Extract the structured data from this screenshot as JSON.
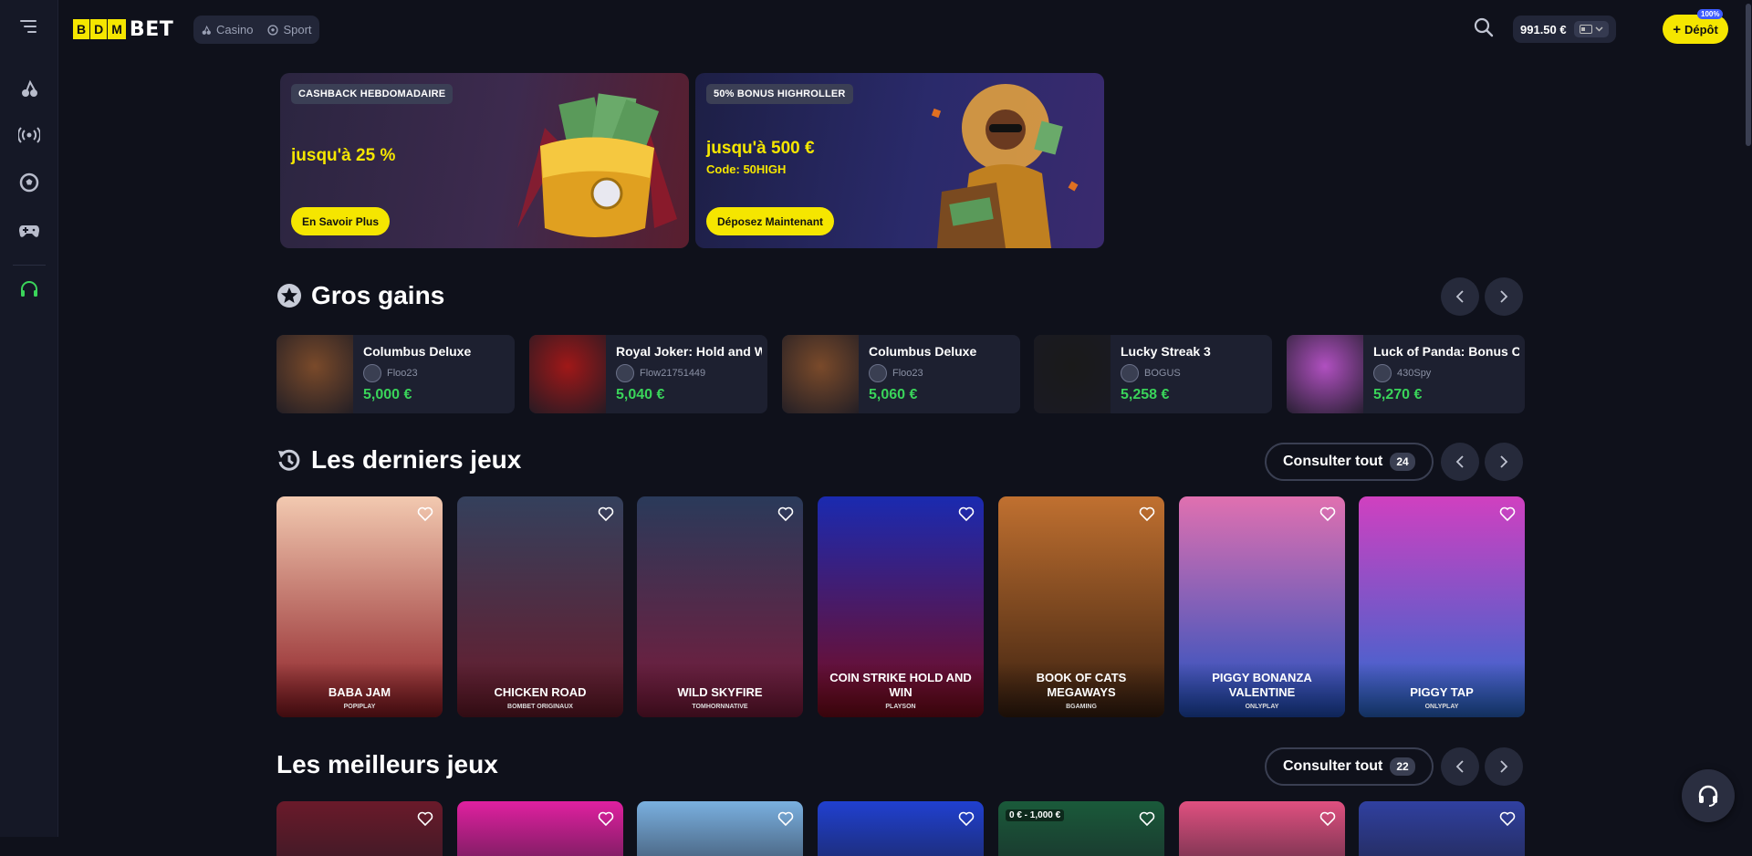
{
  "header": {
    "logo_box": [
      "B",
      "D",
      "M"
    ],
    "logo_text": "BET",
    "nav": [
      {
        "label": "Casino",
        "icon": "cherries-icon"
      },
      {
        "label": "Sport",
        "icon": "soccer-ball-icon"
      }
    ],
    "balance": "991.50 €",
    "deposit_label": "Dépôt",
    "deposit_badge": "100%"
  },
  "sidebar": {
    "items": [
      "menu-icon",
      "cherries-icon",
      "live-broadcast-icon",
      "soccer-ball-icon",
      "gamepad-icon",
      "headset-icon"
    ]
  },
  "banners": [
    {
      "tag": "CASHBACK HEBDOMADAIRE",
      "title": "jusqu'à 25 %",
      "subtitle": "",
      "button": "En Savoir Plus"
    },
    {
      "tag": "50% BONUS HIGHROLLER",
      "title": "jusqu'à 500 €",
      "subtitle": "Code: 50HIGH",
      "button": "Déposez Maintenant"
    }
  ],
  "big_wins": {
    "title": "Gros gains",
    "items": [
      {
        "game": "Columbus Deluxe",
        "user": "Floo23",
        "amount": "5,000 €",
        "thumb_color": "#7a4a2a"
      },
      {
        "game": "Royal Joker: Hold and Win",
        "user": "Flow21751449",
        "amount": "5,040 €",
        "thumb_color": "#a01818"
      },
      {
        "game": "Columbus Deluxe",
        "user": "Floo23",
        "amount": "5,060 €",
        "thumb_color": "#7a4a2a"
      },
      {
        "game": "Lucky Streak 3",
        "user": "BOGUS",
        "amount": "5,258 €",
        "thumb_color": "#1a1a1a"
      },
      {
        "game": "Luck of Panda: Bonus Combo",
        "user": "430Spy",
        "amount": "5,270 €",
        "thumb_color": "#b050c0"
      }
    ]
  },
  "recent_games": {
    "title": "Les derniers jeux",
    "see_all": "Consulter tout",
    "count": "24",
    "items": [
      {
        "name": "Baba Jam",
        "provider": "POPIPLAY",
        "bg_top": "#f2c9b0",
        "bg_bottom": "#8a1a22"
      },
      {
        "name": "Chicken Road",
        "provider": "BOMBET ORIGINAUX",
        "bg_top": "#34405c",
        "bg_bottom": "#6a1a2a"
      },
      {
        "name": "Wild Skyfire",
        "provider": "TOMHORNNATIVE",
        "bg_top": "#2a3a5a",
        "bg_bottom": "#7a1a3a"
      },
      {
        "name": "Coin Strike Hold and Win",
        "provider": "PLAYSON",
        "bg_top": "#1a2ab0",
        "bg_bottom": "#7a0a1a"
      },
      {
        "name": "Book of Cats Megaways",
        "provider": "BGAMING",
        "bg_top": "#c07030",
        "bg_bottom": "#3a2010"
      },
      {
        "name": "Piggy Bonanza Valentine",
        "provider": "ONLYPLAY",
        "bg_top": "#e070b0",
        "bg_bottom": "#2050c0"
      },
      {
        "name": "Piggy Tap",
        "provider": "ONLYPLAY",
        "bg_top": "#d040c0",
        "bg_bottom": "#2a6ad0"
      }
    ]
  },
  "best_games": {
    "title": "Les meilleurs jeux",
    "see_all": "Consulter tout",
    "count": "22",
    "items": [
      {
        "bg": "#6a1a2a"
      },
      {
        "bg": "#e020a0"
      },
      {
        "bg": "#7ab0e0"
      },
      {
        "bg": "#2040d0"
      },
      {
        "bg": "#1a5a3a",
        "label": "0 € - 1,000 €"
      },
      {
        "bg": "#e05080"
      },
      {
        "bg": "#3040a0"
      }
    ]
  }
}
